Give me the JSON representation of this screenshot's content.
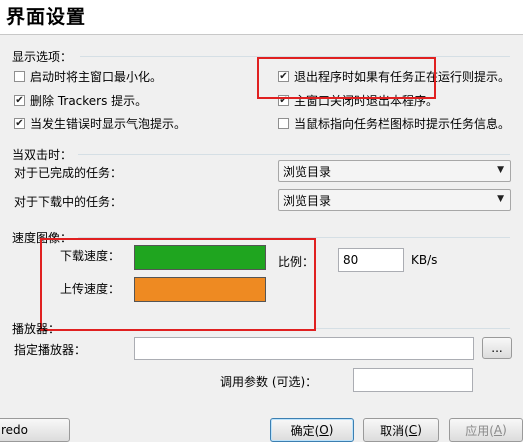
{
  "dialog": {
    "title": "界面设置"
  },
  "display_options": {
    "label": "显示选项：",
    "checkboxes": [
      {
        "label": "启动时将主窗口最小化。",
        "checked": false
      },
      {
        "label": "退出程序时如果有任务正在运行则提示。",
        "checked": true
      },
      {
        "label": "删除 Trackers 提示。",
        "checked": true
      },
      {
        "label": "主窗口关闭时退出本程序。",
        "checked": true
      },
      {
        "label": "当发生错误时显示气泡提示。",
        "checked": true
      },
      {
        "label": "当鼠标指向任务栏图标时提示任务信息。",
        "checked": false
      }
    ]
  },
  "double_click": {
    "label": "当双击时：",
    "completed_label": "对于已完成的任务：",
    "completed_value": "浏览目录",
    "downloading_label": "对于下载中的任务：",
    "downloading_value": "浏览目录"
  },
  "speed_graph": {
    "label": "速度图像：",
    "download_label": "下载速度：",
    "download_color": "#1fa51f",
    "upload_label": "上传速度：",
    "upload_color": "#ee8a22",
    "scale_label": "比例：",
    "scale_value": "80",
    "scale_unit": "KB/s"
  },
  "player": {
    "label": "播放器：",
    "player_label": "指定播放器：",
    "player_value": "",
    "browse_label": "...",
    "params_label": "调用参数 (可选)：",
    "params_value": ""
  },
  "footer": {
    "left_text": "redo",
    "ok_text": "确定(",
    "ok_key": "O",
    "cancel_text": "取消(",
    "cancel_key": "C",
    "apply_text": "应用(",
    "apply_key": "A",
    "close_paren": ")"
  },
  "colors": {
    "annotation": "#e02020"
  }
}
